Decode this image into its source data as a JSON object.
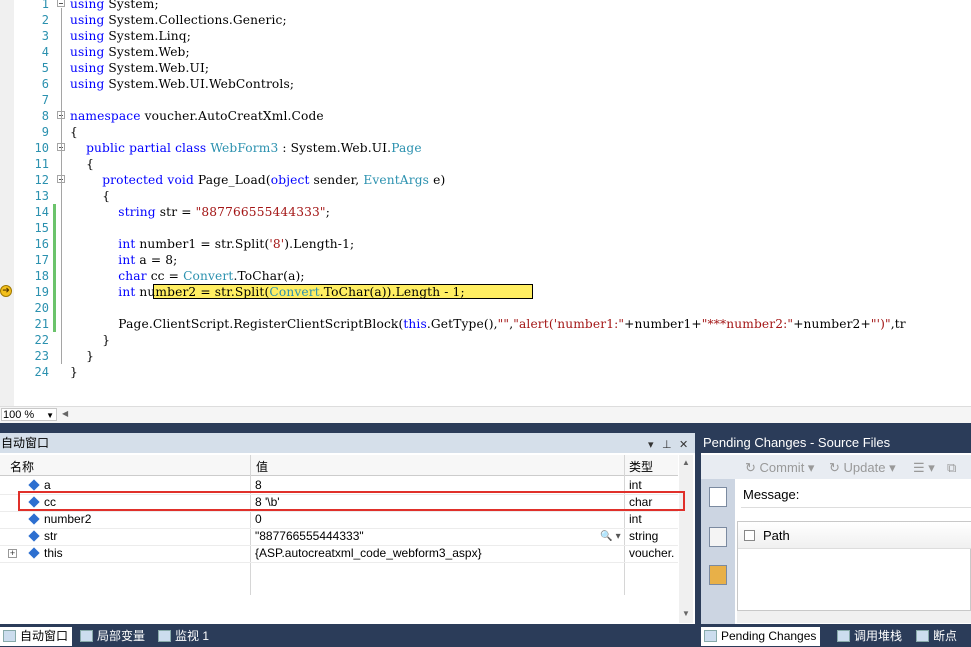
{
  "editor": {
    "lines": [
      {
        "n": "1",
        "code": "using System;"
      },
      {
        "n": "2",
        "code": "using System.Collections.Generic;"
      },
      {
        "n": "3",
        "code": "using System.Linq;"
      },
      {
        "n": "4",
        "code": "using System.Web;"
      },
      {
        "n": "5",
        "code": "using System.Web.UI;"
      },
      {
        "n": "6",
        "code": "using System.Web.UI.WebControls;"
      },
      {
        "n": "7",
        "code": ""
      },
      {
        "n": "8",
        "code": "namespace voucher.AutoCreatXml.Code"
      },
      {
        "n": "9",
        "code": "{"
      },
      {
        "n": "10",
        "code": "    public partial class WebForm3 : System.Web.UI.Page"
      },
      {
        "n": "11",
        "code": "    {"
      },
      {
        "n": "12",
        "code": "        protected void Page_Load(object sender, EventArgs e)"
      },
      {
        "n": "13",
        "code": "        {"
      },
      {
        "n": "14",
        "code": "            string str = \"887766555444333\";"
      },
      {
        "n": "15",
        "code": ""
      },
      {
        "n": "16",
        "code": "            int number1 = str.Split('8').Length-1;"
      },
      {
        "n": "17",
        "code": "            int a = 8;"
      },
      {
        "n": "18",
        "code": "            char cc = Convert.ToChar(a);"
      },
      {
        "n": "19",
        "code": "            int number2 = str.Split(Convert.ToChar(a)).Length - 1;"
      },
      {
        "n": "20",
        "code": ""
      },
      {
        "n": "21",
        "code": "            Page.ClientScript.RegisterClientScriptBlock(this.GetType(),\"\",\"alert('number1:\"+number1+\"***number2:\"+number2+\"')\",tr"
      },
      {
        "n": "22",
        "code": "        }"
      },
      {
        "n": "23",
        "code": "    }"
      },
      {
        "n": "24",
        "code": "}"
      }
    ],
    "zoom": "100 %"
  },
  "autos": {
    "title": "自动窗口",
    "columns": {
      "name": "名称",
      "value": "值",
      "type": "类型"
    },
    "rows": [
      {
        "name": "a",
        "value": "8",
        "type": "int"
      },
      {
        "name": "cc",
        "value": "8 '\\b'",
        "type": "char"
      },
      {
        "name": "number2",
        "value": "0",
        "type": "int"
      },
      {
        "name": "str",
        "value": "\"887766555444333\"",
        "type": "string"
      },
      {
        "name": "this",
        "value": "{ASP.autocreatxml_code_webform3_aspx}",
        "type": "voucher."
      }
    ]
  },
  "bottom_tabs": [
    "自动窗口",
    "局部变量",
    "监视 1"
  ],
  "pending": {
    "title": "Pending Changes - Source Files",
    "commit": "Commit",
    "update": "Update",
    "message_label": "Message:",
    "path_label": "Path"
  },
  "right_tabs": [
    "Pending Changes",
    "调用堆栈",
    "断点"
  ]
}
